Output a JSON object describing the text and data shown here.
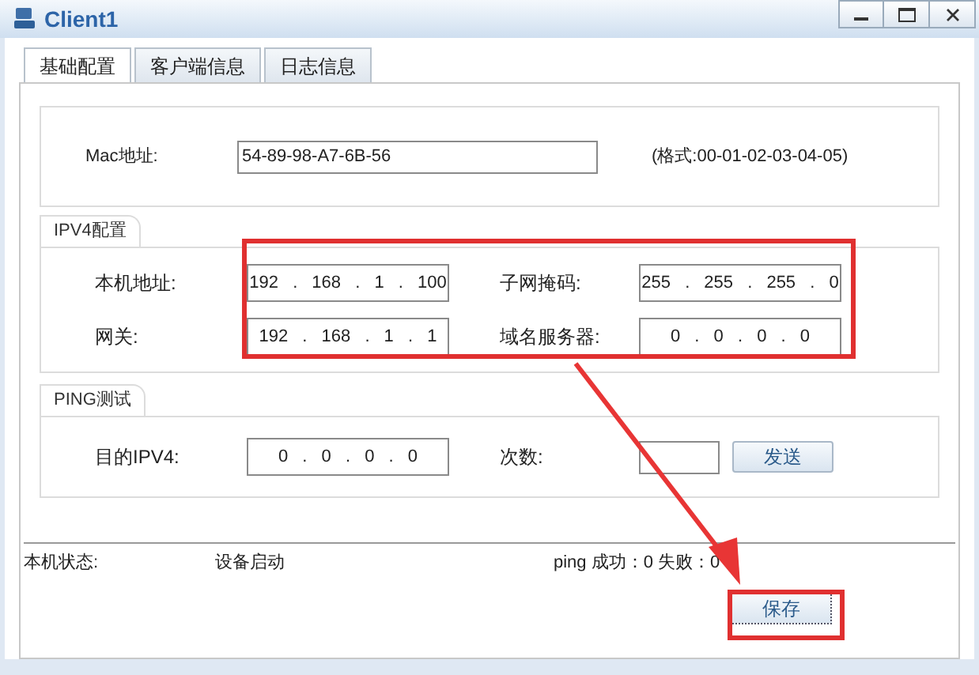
{
  "window": {
    "title": "Client1"
  },
  "tabs": [
    {
      "label": "基础配置",
      "selected": true
    },
    {
      "label": "客户端信息",
      "selected": false
    },
    {
      "label": "日志信息",
      "selected": false
    }
  ],
  "mac": {
    "label": "Mac地址:",
    "value": "54-89-98-A7-6B-56",
    "hint": "(格式:00-01-02-03-04-05)"
  },
  "ipv4": {
    "title": "IPV4配置",
    "fields": [
      {
        "label": "本机地址:",
        "value": "192 . 168 . 1 . 100"
      },
      {
        "label": "子网掩码:",
        "value": "255 . 255 . 255 . 0"
      },
      {
        "label": "网关:",
        "value": "192 . 168 . 1 . 1"
      },
      {
        "label": "域名服务器:",
        "value": "0 . 0 . 0 . 0"
      }
    ]
  },
  "ping": {
    "title": "PING测试",
    "target_label": "目的IPV4:",
    "target_value": "0 . 0 . 0 . 0",
    "count_label": "次数:",
    "send_button": "发送"
  },
  "status": {
    "label": "本机状态:",
    "value": "设备启动",
    "ping_result": "ping 成功：0 失败：0"
  },
  "save_button": "保存"
}
